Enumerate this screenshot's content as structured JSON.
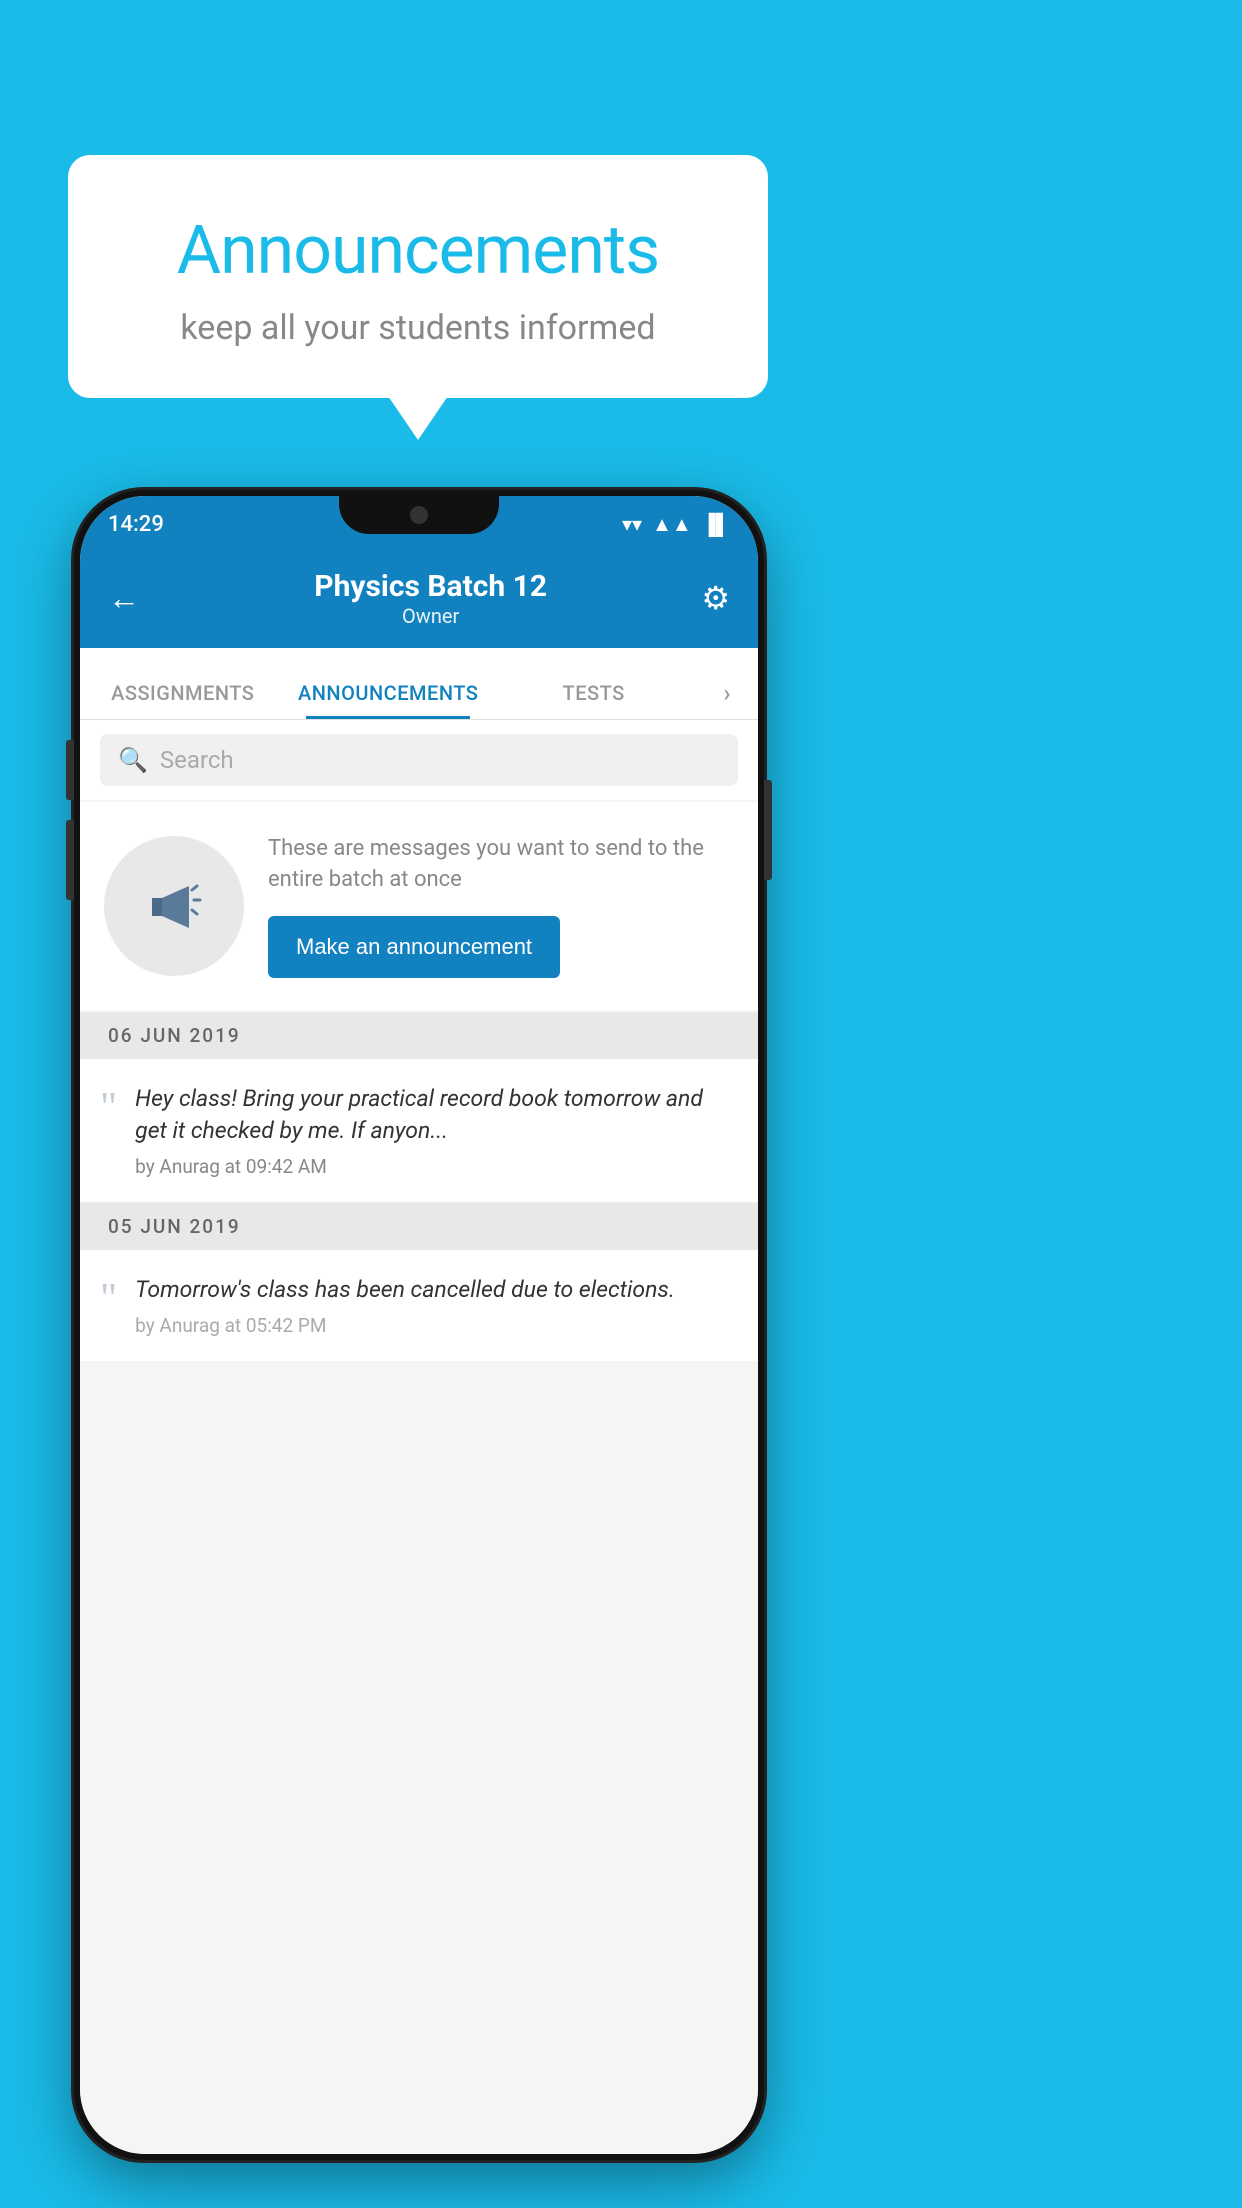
{
  "background_color": "#1ABBE8",
  "speech_bubble": {
    "title": "Announcements",
    "subtitle": "keep all your students informed"
  },
  "phone": {
    "status_bar": {
      "time": "14:29",
      "wifi_symbol": "▼",
      "signal_symbol": "▲",
      "battery_symbol": "▐"
    },
    "app_bar": {
      "back_label": "←",
      "title": "Physics Batch 12",
      "subtitle": "Owner",
      "gear_symbol": "⚙"
    },
    "tabs": [
      {
        "label": "ASSIGNMENTS",
        "active": false
      },
      {
        "label": "ANNOUNCEMENTS",
        "active": true
      },
      {
        "label": "TESTS",
        "active": false
      },
      {
        "label": "›",
        "active": false
      }
    ],
    "search": {
      "placeholder": "Search",
      "icon": "🔍"
    },
    "announcement_cta": {
      "description_text": "These are messages you want to send to the entire batch at once",
      "button_label": "Make an announcement"
    },
    "date_sections": [
      {
        "date_label": "06  JUN  2019",
        "announcements": [
          {
            "text": "Hey class! Bring your practical record book tomorrow and get it checked by me. If anyon...",
            "meta": "by Anurag at 09:42 AM"
          }
        ]
      },
      {
        "date_label": "05  JUN  2019",
        "announcements": [
          {
            "text": "Tomorrow's class has been cancelled due to elections.",
            "meta": "by Anurag at 05:42 PM"
          }
        ]
      }
    ]
  }
}
